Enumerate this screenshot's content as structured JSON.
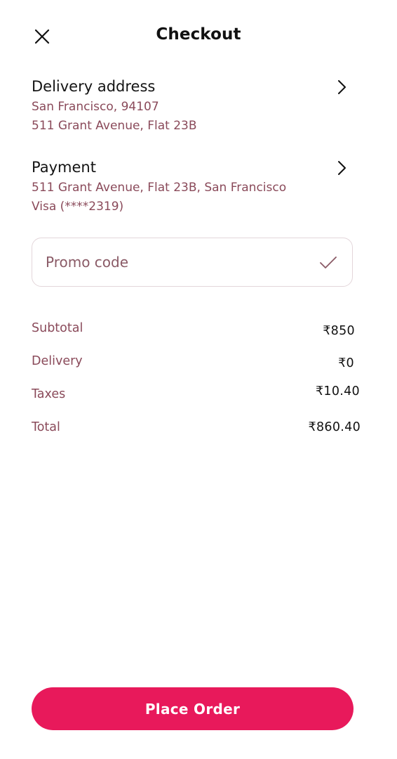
{
  "header": {
    "title": "Checkout",
    "close_icon": "close-icon"
  },
  "delivery": {
    "title": "Delivery address",
    "line1": "San Francisco, 94107",
    "line2": "511 Grant Avenue, Flat 23B",
    "chevron_icon": "chevron-right-icon"
  },
  "payment": {
    "title": "Payment",
    "line1": "511 Grant Avenue, Flat 23B, San Francisco",
    "line2": "Visa (****2319)",
    "chevron_icon": "chevron-right-icon"
  },
  "promo": {
    "placeholder": "Promo code",
    "value": "",
    "apply_icon": "check-icon"
  },
  "summary": {
    "subtotal": {
      "label": "Subtotal",
      "value": "₹850"
    },
    "delivery": {
      "label": "Delivery",
      "value": "₹0"
    },
    "taxes": {
      "label": "Taxes",
      "value": "₹10.40"
    },
    "total": {
      "label": "Total",
      "value": "₹860.40"
    }
  },
  "actions": {
    "place_order_label": "Place Order"
  },
  "colors": {
    "accent": "#e8195b",
    "secondary_text": "#8a4a5a",
    "primary_text": "#111111",
    "border": "#e3d6da"
  }
}
